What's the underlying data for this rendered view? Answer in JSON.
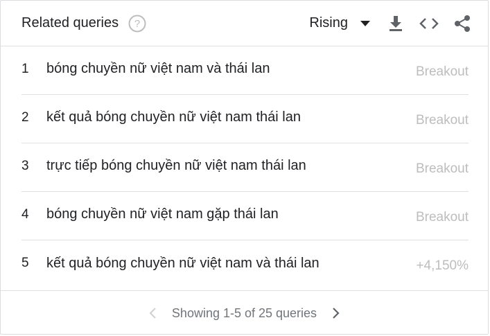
{
  "header": {
    "title": "Related queries",
    "dropdown_value": "Rising"
  },
  "icons": {
    "help": "help-circle-icon",
    "caret": "caret-down-icon",
    "download": "download-icon",
    "embed": "code-embed-icon",
    "share": "share-icon",
    "prev": "chevron-left-icon",
    "next": "chevron-right-icon"
  },
  "rows": [
    {
      "rank": "1",
      "query": "bóng chuyền nữ việt nam và thái lan",
      "value": "Breakout"
    },
    {
      "rank": "2",
      "query": "kết quả bóng chuyền nữ việt nam thái lan",
      "value": "Breakout"
    },
    {
      "rank": "3",
      "query": "trực tiếp bóng chuyền nữ việt nam thái lan",
      "value": "Breakout"
    },
    {
      "rank": "4",
      "query": "bóng chuyền nữ việt nam gặp thái lan",
      "value": "Breakout"
    },
    {
      "rank": "5",
      "query": "kết quả bóng chuyền nữ việt nam và thái lan",
      "value": "+4,150%"
    }
  ],
  "pagination": {
    "text": "Showing 1-5 of 25 queries"
  },
  "colors": {
    "text": "#202124",
    "muted": "#bdbdbd",
    "icon": "#5f6368",
    "divider": "#e0e0e0"
  }
}
